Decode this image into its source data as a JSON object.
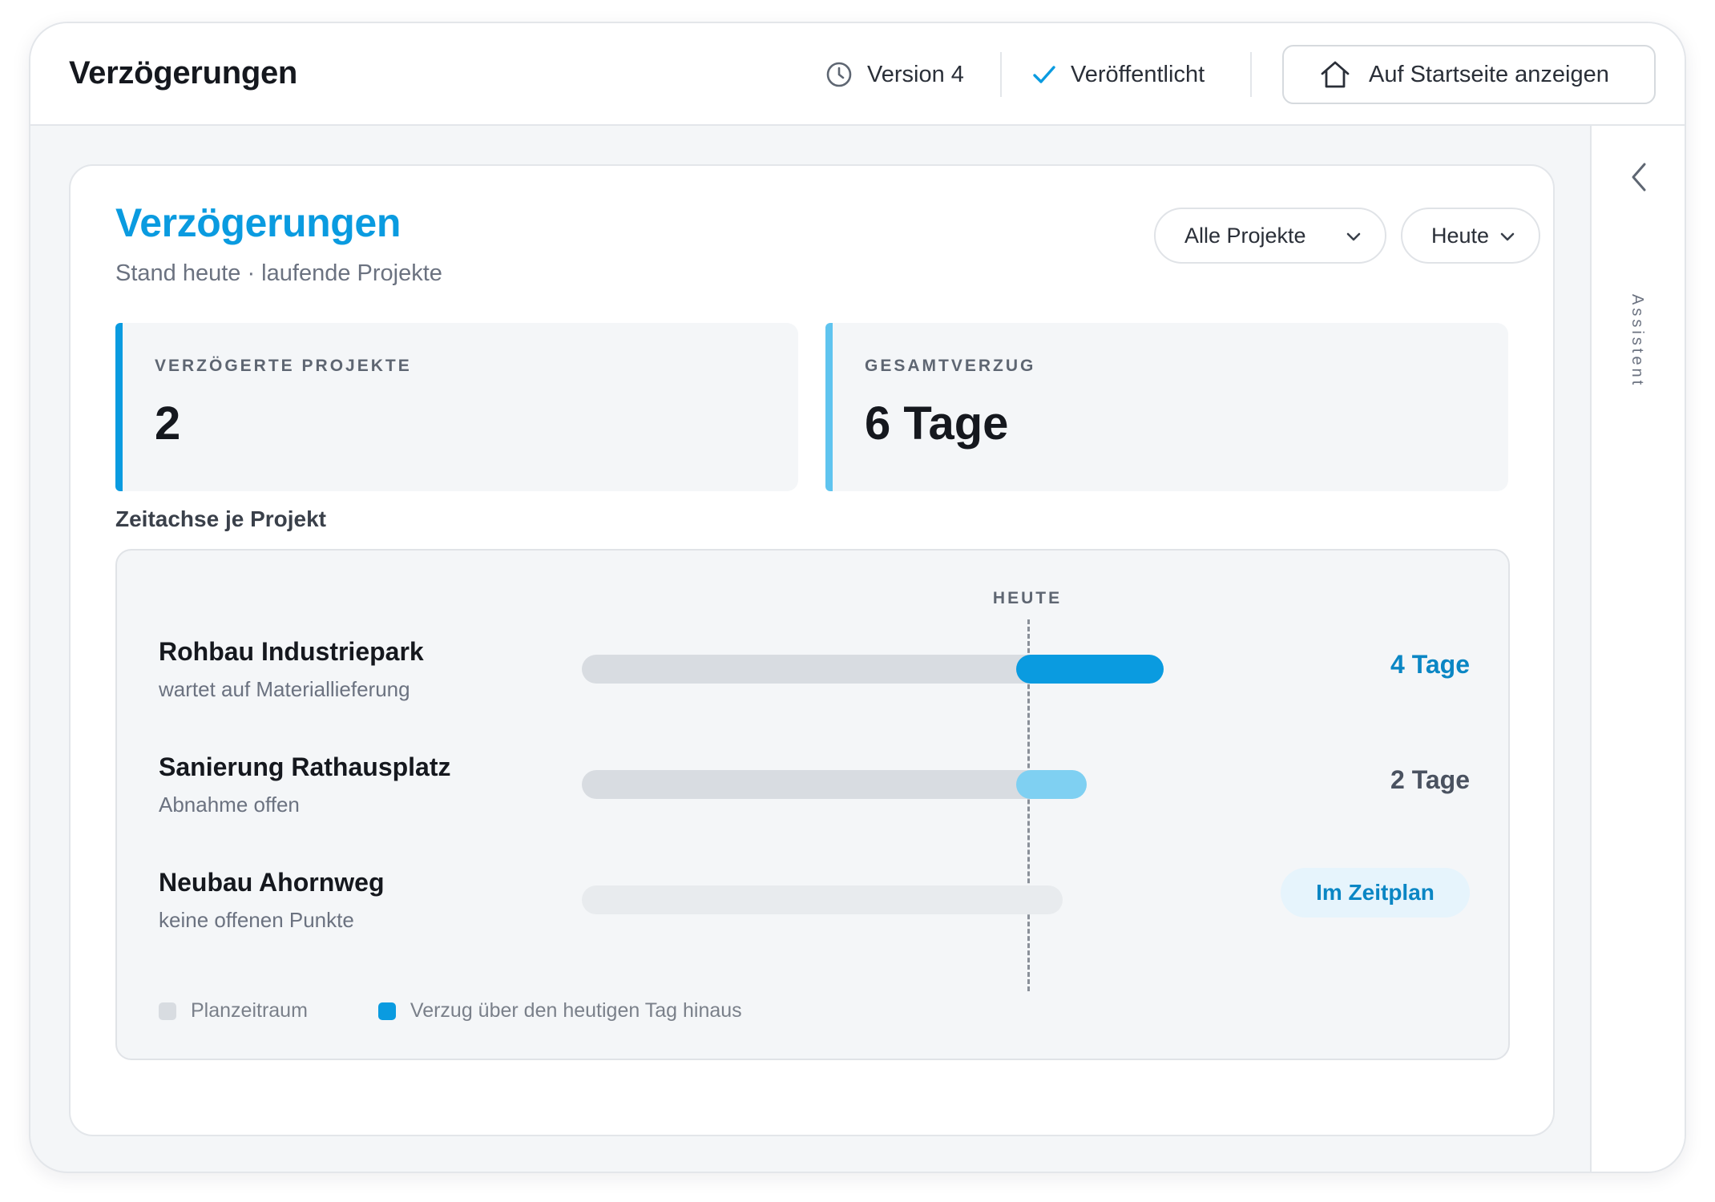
{
  "topbar": {
    "title": "Verzögerungen",
    "version": "Version 4",
    "status": "Veröffentlicht",
    "home_button": "Auf Startseite anzeigen"
  },
  "side_panel": {
    "label": "Assistent"
  },
  "card": {
    "title": "Verzögerungen",
    "subtitle": "Stand heute · laufende Projekte",
    "filters": {
      "projects": "Alle Projekte",
      "date": "Heute"
    }
  },
  "stats": [
    {
      "label": "VERZÖGERTE PROJEKTE",
      "value": "2"
    },
    {
      "label": "GESAMTVERZUG",
      "value": "6 Tage"
    }
  ],
  "timeline": {
    "section_label": "Zeitachse je Projekt",
    "today_label": "HEUTE",
    "rows": [
      {
        "name": "Rohbau Industriepark",
        "note": "wartet auf Materiallieferung",
        "delay_days": 4,
        "value": "4 Tage",
        "status": "delayed"
      },
      {
        "name": "Sanierung Rathausplatz",
        "note": "Abnahme offen",
        "delay_days": 2,
        "value": "2 Tage",
        "status": "delayed"
      },
      {
        "name": "Neubau Ahornweg",
        "note": "keine offenen Punkte",
        "delay_days": 0,
        "value": "Im Zeitplan",
        "status": "on-time"
      }
    ],
    "legend": [
      {
        "label": "Planzeitraum",
        "color": "#d8dce1"
      },
      {
        "label": "Verzug über den heutigen Tag hinaus",
        "color": "#0a9be0"
      }
    ]
  },
  "colors": {
    "accent": "#0a9be0",
    "accent_light": "#7fd0f2",
    "value_primary": "#0a86c4",
    "value_secondary": "#4a5260"
  }
}
